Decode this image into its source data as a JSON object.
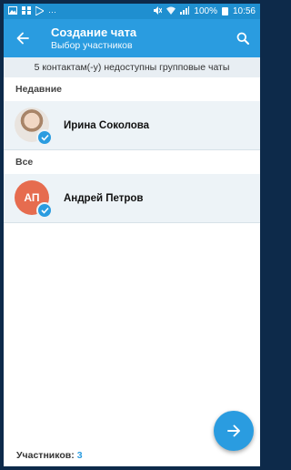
{
  "status": {
    "time": "10:56",
    "battery": "100%",
    "left_icons": [
      "gallery-icon",
      "grid-icon",
      "play-store-icon",
      "more-dots-icon"
    ],
    "dots": "···"
  },
  "appbar": {
    "title": "Создание чата",
    "subtitle": "Выбор участников"
  },
  "notice": "5 контактам(-у) недоступны групповые чаты",
  "sections": {
    "recent": "Недавние",
    "all": "Все"
  },
  "contacts": [
    {
      "name": "Ирина Соколова",
      "avatar": "photo",
      "selected": true
    },
    {
      "name": "Андрей Петров",
      "initials": "АП",
      "selected": true
    }
  ],
  "footer": {
    "label": "Участников:",
    "count": "3"
  },
  "colors": {
    "accent": "#2a9ce0",
    "statusbar": "#1f8fd0",
    "row_bg": "#edf3f7",
    "avatar_initials_bg": "#e66c4f"
  }
}
